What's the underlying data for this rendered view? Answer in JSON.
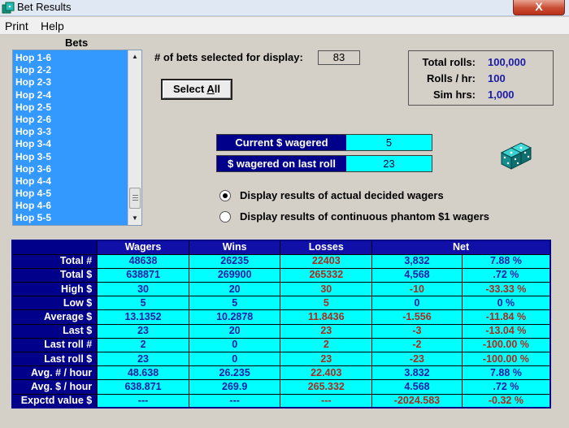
{
  "window": {
    "title": "Bet Results",
    "close_label": "X"
  },
  "menu": {
    "items": [
      "Print",
      "Help"
    ]
  },
  "bets": {
    "label": "Bets",
    "items": [
      "Hop 1-6",
      "Hop 2-2",
      "Hop 2-3",
      "Hop 2-4",
      "Hop 2-5",
      "Hop 2-6",
      "Hop 3-3",
      "Hop 3-4",
      "Hop 3-5",
      "Hop 3-6",
      "Hop 4-4",
      "Hop 4-5",
      "Hop 4-6",
      "Hop 5-5"
    ]
  },
  "display": {
    "count_label": "# of bets selected for display:",
    "count_value": "83",
    "select_all_label": "Select All"
  },
  "stats": [
    {
      "label": "Total rolls:",
      "value": "100,000"
    },
    {
      "label": "Rolls / hr:",
      "value": "100"
    },
    {
      "label": "Sim hrs:",
      "value": "1,000"
    }
  ],
  "wagers": {
    "current_label": "Current $ wagered",
    "current_value": "5",
    "last_label": "$ wagered on last roll",
    "last_value": "23"
  },
  "options": {
    "actual_label": "Display results of actual decided wagers",
    "phantom_label": "Display results of continuous phantom $1 wagers",
    "selected": "actual"
  },
  "colors": {
    "header_bg": "#00008b",
    "cell_bg": "#00ffff",
    "list_bg": "#3399ff",
    "value_blue": "#1a1aa8",
    "value_red": "#b22a1a"
  },
  "table": {
    "headers": [
      "",
      "Wagers",
      "Wins",
      "Losses",
      "Net"
    ],
    "rows": [
      {
        "label": "Total #",
        "wagers": "48638",
        "wins": "26235",
        "losses": "22403",
        "net": "3,832",
        "pct": "7.88 %"
      },
      {
        "label": "Total $",
        "wagers": "638871",
        "wins": "269900",
        "losses": "265332",
        "net": "4,568",
        "pct": ".72 %"
      },
      {
        "label": "High $",
        "wagers": "30",
        "wins": "20",
        "losses": "30",
        "net": "-10",
        "pct": "-33.33 %"
      },
      {
        "label": "Low $",
        "wagers": "5",
        "wins": "5",
        "losses": "5",
        "net": "0",
        "pct": "0 %"
      },
      {
        "label": "Average $",
        "wagers": "13.1352",
        "wins": "10.2878",
        "losses": "11.8436",
        "net": "-1.556",
        "pct": "-11.84 %"
      },
      {
        "label": "Last $",
        "wagers": "23",
        "wins": "20",
        "losses": "23",
        "net": "-3",
        "pct": "-13.04 %"
      },
      {
        "label": "Last roll #",
        "wagers": "2",
        "wins": "0",
        "losses": "2",
        "net": "-2",
        "pct": "-100.00 %"
      },
      {
        "label": "Last roll $",
        "wagers": "23",
        "wins": "0",
        "losses": "23",
        "net": "-23",
        "pct": "-100.00 %"
      },
      {
        "label": "Avg. # / hour",
        "wagers": "48.638",
        "wins": "26.235",
        "losses": "22.403",
        "net": "3.832",
        "pct": "7.88 %"
      },
      {
        "label": "Avg. $ / hour",
        "wagers": "638.871",
        "wins": "269.9",
        "losses": "265.332",
        "net": "4.568",
        "pct": ".72 %"
      },
      {
        "label": "Expctd value $",
        "wagers": "---",
        "wins": "---",
        "losses": "---",
        "net": "-2024.583",
        "pct": "-0.32 %"
      }
    ]
  }
}
